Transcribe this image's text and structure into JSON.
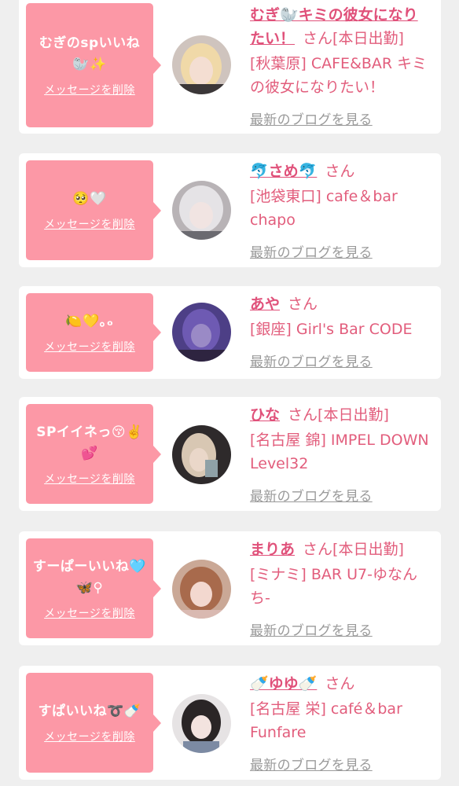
{
  "cards": [
    {
      "message": "むぎのspいいね🦭✨",
      "delete_label": "メッセージを削除",
      "name": "むぎ🦭キミの彼女になりたい！",
      "honorific": "さん",
      "status": "[本日出勤]",
      "shop": "[秋葉原] CAFE&BAR キミの彼女になりたい！",
      "blog_link": "最新のブログを見る"
    },
    {
      "message": "🥺🤍",
      "delete_label": "メッセージを削除",
      "name": "🐬さめ🐬",
      "honorific": "さん",
      "status": "",
      "shop": "[池袋東口] cafe＆bar chapo",
      "blog_link": "最新のブログを見る"
    },
    {
      "message": "🍋💛｡ₒ",
      "delete_label": "メッセージを削除",
      "name": "あや",
      "honorific": "さん",
      "status": "",
      "shop": "[銀座] Girl's Bar CODE",
      "blog_link": "最新のブログを見る"
    },
    {
      "message": "SPイイネっ😚✌️💕",
      "delete_label": "メッセージを削除",
      "name": "ひな",
      "honorific": "さん",
      "status": "[本日出勤]",
      "shop": "[名古屋 錦] IMPEL DOWN Level32",
      "blog_link": "最新のブログを見る"
    },
    {
      "message": "すーぱーいいね🩵🦋⚲",
      "delete_label": "メッセージを削除",
      "name": "まりあ",
      "honorific": "さん",
      "status": "[本日出勤]",
      "shop": "[ミナミ] BAR U7-ゆなんち-",
      "blog_link": "最新のブログを見る"
    },
    {
      "message": "すぱいいね➰🍼",
      "delete_label": "メッセージを削除",
      "name": "🍼ゆゆ🍼",
      "honorific": "さん",
      "status": "",
      "shop": "[名古屋 栄] café＆bar Funfare",
      "blog_link": "最新のブログを見る"
    }
  ],
  "colors": {
    "bubble": "#fc98a6",
    "accent_text": "#e25d7c",
    "link_gray": "#9a9a9a",
    "page_bg": "#efefef"
  }
}
